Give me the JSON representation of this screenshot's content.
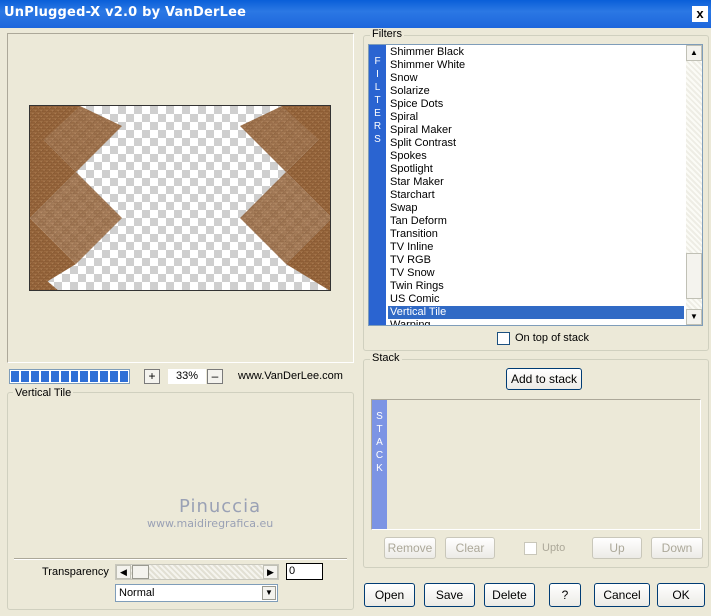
{
  "window": {
    "title": "UnPlugged-X v2.0 by VanDerLee",
    "close_label": "x"
  },
  "preview": {
    "zoom": "33%",
    "zoom_in": "+",
    "zoom_out": "–",
    "url": "www.VanDerLee.com",
    "progress_fraction": 1.0
  },
  "settings": {
    "title": "Vertical Tile",
    "watermark_name": "Pinuccia",
    "watermark_site": "www.maidiregrafica.eu",
    "transparency_label": "Transparency",
    "transparency_value": "0",
    "blend_mode": "Normal"
  },
  "filters": {
    "title": "Filters",
    "strip_letters": [
      "F",
      "I",
      "L",
      "T",
      "E",
      "R",
      "S"
    ],
    "items": [
      "Shimmer Black",
      "Shimmer White",
      "Snow",
      "Solarize",
      "Spice Dots",
      "Spiral",
      "Spiral Maker",
      "Split Contrast",
      "Spokes",
      "Spotlight",
      "Star Maker",
      "Starchart",
      "Swap",
      "Tan Deform",
      "Transition",
      "TV Inline",
      "TV RGB",
      "TV Snow",
      "Twin Rings",
      "US Comic",
      "Vertical Tile",
      "Warping"
    ],
    "selected": "Vertical Tile",
    "on_top_label": "On top of stack",
    "on_top_checked": false
  },
  "stack": {
    "title": "Stack",
    "add_label": "Add to stack",
    "strip_letters": [
      "S",
      "T",
      "A",
      "C",
      "K"
    ],
    "remove_label": "Remove",
    "clear_label": "Clear",
    "upto_label": "Upto",
    "up_label": "Up",
    "down_label": "Down"
  },
  "footer": {
    "open": "Open",
    "save": "Save",
    "delete": "Delete",
    "help": "?",
    "cancel": "Cancel",
    "ok": "OK"
  }
}
